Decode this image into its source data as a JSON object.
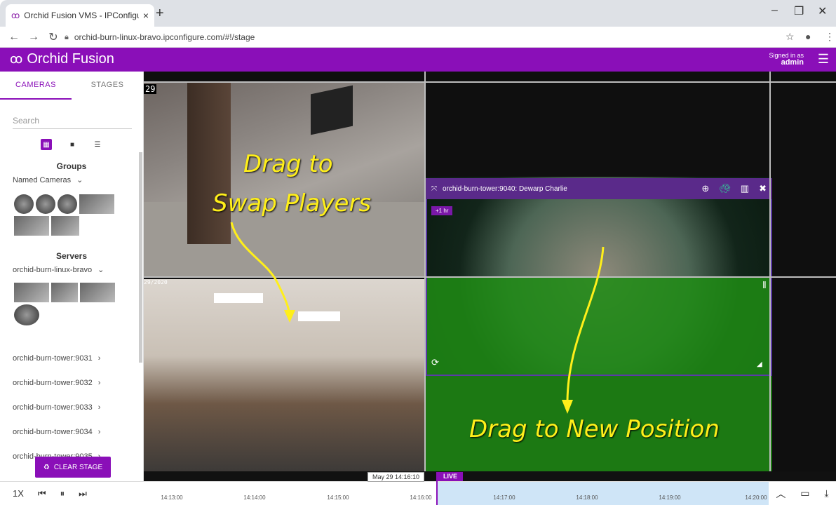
{
  "browser": {
    "tab_title": "Orchid Fusion VMS - IPConfigure",
    "tab_close": "×",
    "new_tab": "+",
    "url": "orchid-burn-linux-bravo.ipconfigure.com/#!/stage",
    "minimize": "–",
    "restore": "❐",
    "close": "✕"
  },
  "app": {
    "title": "Orchid Fusion",
    "signed_in_label": "Signed in as",
    "user": "admin",
    "accent": "#8a0fb8"
  },
  "sidebar": {
    "tabs": [
      {
        "label": "CAMERAS"
      },
      {
        "label": "STAGES"
      }
    ],
    "search_placeholder": "Search",
    "groups_title": "Groups",
    "group_dropdown": "Named Cameras",
    "servers_title": "Servers",
    "server_dropdown": "orchid-burn-linux-bravo",
    "servers": [
      {
        "label": "orchid-burn-tower:9031"
      },
      {
        "label": "orchid-burn-tower:9032"
      },
      {
        "label": "orchid-burn-tower:9033"
      },
      {
        "label": "orchid-burn-tower:9034"
      },
      {
        "label": "orchid-burn-tower:9035"
      }
    ],
    "clear_stage": "CLEAR STAGE"
  },
  "stage": {
    "ts1": "29",
    "ts2": "29/2020",
    "player_title": "orchid-burn-tower:9040: Dewarp Charlie",
    "time_tag": "+1 hr",
    "annotations": {
      "swap_line1": "Drag to",
      "swap_line2": "Swap Players",
      "new_position": "Drag to New Position"
    }
  },
  "timeline": {
    "speed": "1X",
    "tooltip": "May 29 14:16:10",
    "live": "LIVE",
    "ticks": [
      "14:13:00",
      "14:14:00",
      "14:15:00",
      "14:16:00",
      "14:17:00",
      "14:18:00",
      "14:19:00",
      "14:20:00"
    ]
  }
}
